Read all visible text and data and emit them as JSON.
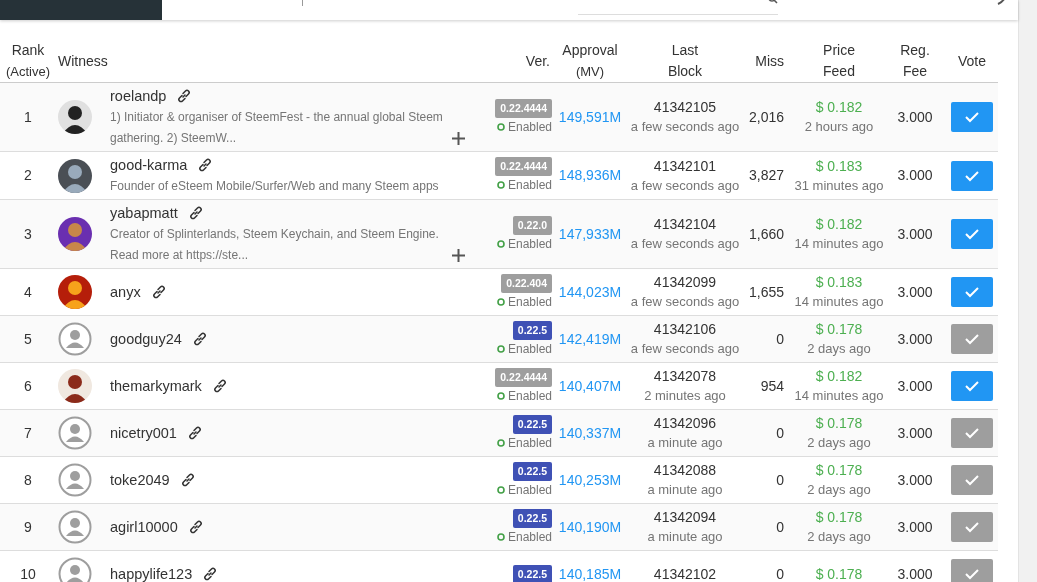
{
  "columns": [
    {
      "label": "Rank",
      "sub": "(Active)"
    },
    {
      "label": "Witness"
    },
    {
      "label": "Ver."
    },
    {
      "label": "Approval",
      "sub": "(MV)"
    },
    {
      "label": "Last",
      "sub": "Block"
    },
    {
      "label": "Miss"
    },
    {
      "label": "Price",
      "sub": "Feed"
    },
    {
      "label": "Reg.",
      "sub": "Fee"
    },
    {
      "label": "Vote"
    }
  ],
  "rows": [
    {
      "rank": "1",
      "name": "roelandp",
      "has_photo": true,
      "description": "1) Initiator & organiser of SteemFest - the annual global Steem gathering. 2) SteemW...",
      "expandable": true,
      "version": "0.22.4444",
      "color": "#9e9e9e",
      "status": "Enabled",
      "approval": "149,591M",
      "last_block": "41342105",
      "last_block_time": "a few seconds ago",
      "miss": "2,016",
      "price": "$ 0.182",
      "price_time": "2 hours ago",
      "fee": "3.000",
      "voted": true
    },
    {
      "rank": "2",
      "name": "good-karma",
      "has_photo": true,
      "description": "Founder of eSteem Mobile/Surfer/Web and many Steem apps",
      "version": "0.22.4444",
      "color": "#9e9e9e",
      "status": "Enabled",
      "approval": "148,936M",
      "last_block": "41342101",
      "last_block_time": "a few seconds ago",
      "miss": "3,827",
      "price": "$ 0.183",
      "price_time": "31 minutes ago",
      "fee": "3.000",
      "voted": true
    },
    {
      "rank": "3",
      "name": "yabapmatt",
      "has_photo": true,
      "description": "Creator of Splinterlands, Steem Keychain, and Steem Engine. Read more at https://ste...",
      "expandable": true,
      "version": "0.22.0",
      "color": "#9e9e9e",
      "status": "Enabled",
      "approval": "147,933M",
      "last_block": "41342104",
      "last_block_time": "a few seconds ago",
      "miss": "1,660",
      "price": "$ 0.182",
      "price_time": "14 minutes ago",
      "fee": "3.000",
      "voted": true
    },
    {
      "rank": "4",
      "name": "anyx",
      "has_photo": true,
      "version": "0.22.404",
      "color": "#9e9e9e",
      "status": "Enabled",
      "approval": "144,023M",
      "last_block": "41342099",
      "last_block_time": "a few seconds ago",
      "miss": "1,655",
      "price": "$ 0.183",
      "price_time": "14 minutes ago",
      "fee": "3.000",
      "voted": true
    },
    {
      "rank": "5",
      "name": "goodguy24",
      "has_photo": false,
      "version": "0.22.5",
      "color": "#3f51b5",
      "status": "Enabled",
      "approval": "142,419M",
      "last_block": "41342106",
      "last_block_time": "a few seconds ago",
      "miss": "0",
      "price": "$ 0.178",
      "price_time": "2 days ago",
      "fee": "3.000",
      "voted": false
    },
    {
      "rank": "6",
      "name": "themarkymark",
      "has_photo": true,
      "version": "0.22.4444",
      "color": "#9e9e9e",
      "status": "Enabled",
      "approval": "140,407M",
      "last_block": "41342078",
      "last_block_time": "2 minutes ago",
      "miss": "954",
      "price": "$ 0.182",
      "price_time": "14 minutes ago",
      "fee": "3.000",
      "voted": true
    },
    {
      "rank": "7",
      "name": "nicetry001",
      "has_photo": false,
      "version": "0.22.5",
      "color": "#3f51b5",
      "status": "Enabled",
      "approval": "140,337M",
      "last_block": "41342096",
      "last_block_time": "a minute ago",
      "miss": "0",
      "price": "$ 0.178",
      "price_time": "2 days ago",
      "fee": "3.000",
      "voted": false
    },
    {
      "rank": "8",
      "name": "toke2049",
      "has_photo": false,
      "version": "0.22.5",
      "color": "#3f51b5",
      "status": "Enabled",
      "approval": "140,253M",
      "last_block": "41342088",
      "last_block_time": "a minute ago",
      "miss": "0",
      "price": "$ 0.178",
      "price_time": "2 days ago",
      "fee": "3.000",
      "voted": false
    },
    {
      "rank": "9",
      "name": "agirl10000",
      "has_photo": false,
      "version": "0.22.5",
      "color": "#3f51b5",
      "status": "Enabled",
      "approval": "140,190M",
      "last_block": "41342094",
      "last_block_time": "a minute ago",
      "miss": "0",
      "price": "$ 0.178",
      "price_time": "2 days ago",
      "fee": "3.000",
      "voted": false
    },
    {
      "rank": "10",
      "name": "happylife123",
      "has_photo": false,
      "version": "0.22.5",
      "color": "#3f51b5",
      "approval": "140,185M",
      "last_block": "41342102",
      "miss": "0",
      "price": "$ 0.178",
      "fee": "3.000",
      "voted": false
    }
  ]
}
